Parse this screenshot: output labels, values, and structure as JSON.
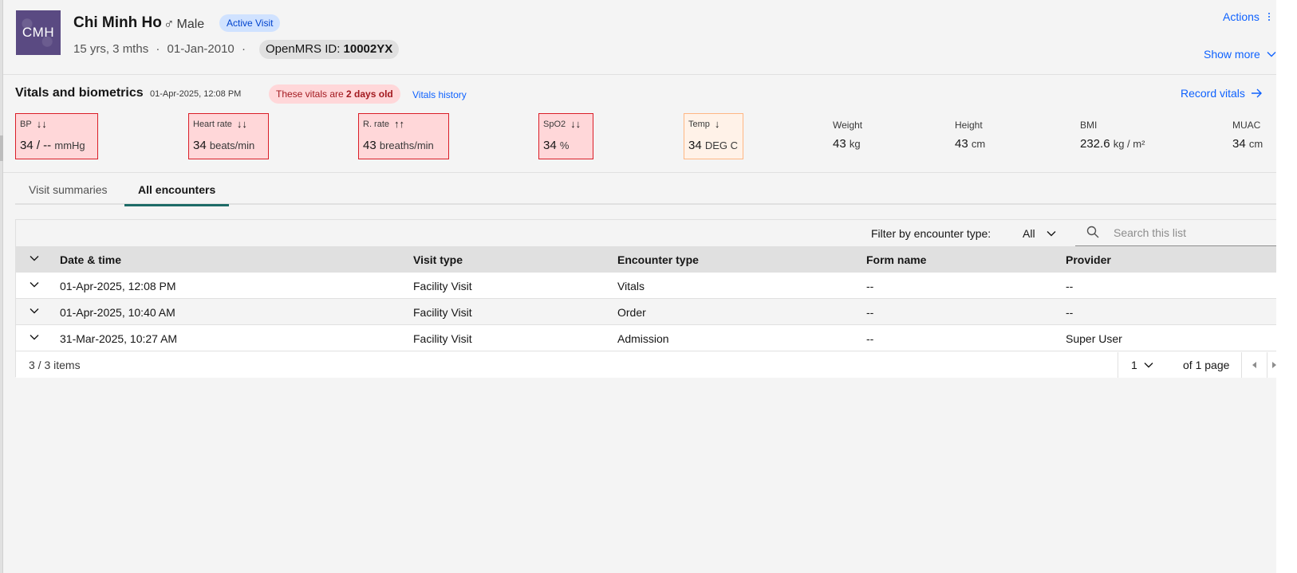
{
  "header": {
    "avatar_initials": "CMH",
    "name": "Chi Minh Ho",
    "gender_symbol": "♂",
    "gender": "Male",
    "visit_status": "Active Visit",
    "age": "15 yrs, 3 mths",
    "dob": "01-Jan-2010",
    "separator": "·",
    "id_label": "OpenMRS ID: ",
    "id_value": "10002YX",
    "actions_label": "Actions",
    "show_more_label": "Show more"
  },
  "vitals": {
    "title": "Vitals and biometrics",
    "date": "01-Apr-2025, 12:08 PM",
    "age_prefix": "These vitals are ",
    "age_value": "2 days old",
    "history_label": "Vitals history",
    "record_label": "Record vitals",
    "tiles": [
      {
        "label": "BP",
        "arrows": "↓↓",
        "value": "34 / --",
        "unit": "mmHg",
        "status": "critical"
      },
      {
        "label": "Heart rate",
        "arrows": "↓↓",
        "value": "34",
        "unit": "beats/min",
        "status": "critical"
      },
      {
        "label": "R. rate",
        "arrows": "↑↑",
        "value": "43",
        "unit": "breaths/min",
        "status": "critical"
      },
      {
        "label": "SpO2",
        "arrows": "↓↓",
        "value": "34",
        "unit": "%",
        "status": "critical"
      },
      {
        "label": "Temp",
        "arrows": "↓",
        "value": "34",
        "unit": "DEG C",
        "status": "warning"
      }
    ],
    "biometrics": [
      {
        "label": "Weight",
        "value": "43",
        "unit": "kg"
      },
      {
        "label": "Height",
        "value": "43",
        "unit": "cm"
      },
      {
        "label": "BMI",
        "value": "232.6",
        "unit": "kg / m²"
      },
      {
        "label": "MUAC",
        "value": "34",
        "unit": "cm"
      }
    ]
  },
  "tabs": [
    {
      "label": "Visit summaries",
      "active": false
    },
    {
      "label": "All encounters",
      "active": true
    }
  ],
  "table": {
    "filter_label": "Filter by encounter type:",
    "filter_value": "All",
    "search_placeholder": "Search this list",
    "headers": [
      "Date & time",
      "Visit type",
      "Encounter type",
      "Form name",
      "Provider"
    ],
    "rows": [
      [
        "01-Apr-2025, 12:08 PM",
        "Facility Visit",
        "Vitals",
        "--",
        "--"
      ],
      [
        "01-Apr-2025, 10:40 AM",
        "Facility Visit",
        "Order",
        "--",
        "--"
      ],
      [
        "31-Mar-2025, 10:27 AM",
        "Facility Visit",
        "Admission",
        "--",
        "Super User"
      ]
    ],
    "pagination": {
      "items_text": "3 / 3 items",
      "current_page": "1",
      "of_pages": "of 1 page"
    }
  },
  "colors": {
    "link": "#0f62fe",
    "critical_bg": "#ffd7d9",
    "critical_border": "#da1e28",
    "warning_bg": "#fff2e8",
    "active_tab": "#1d6b67",
    "avatar_bg": "#5a4a82"
  }
}
